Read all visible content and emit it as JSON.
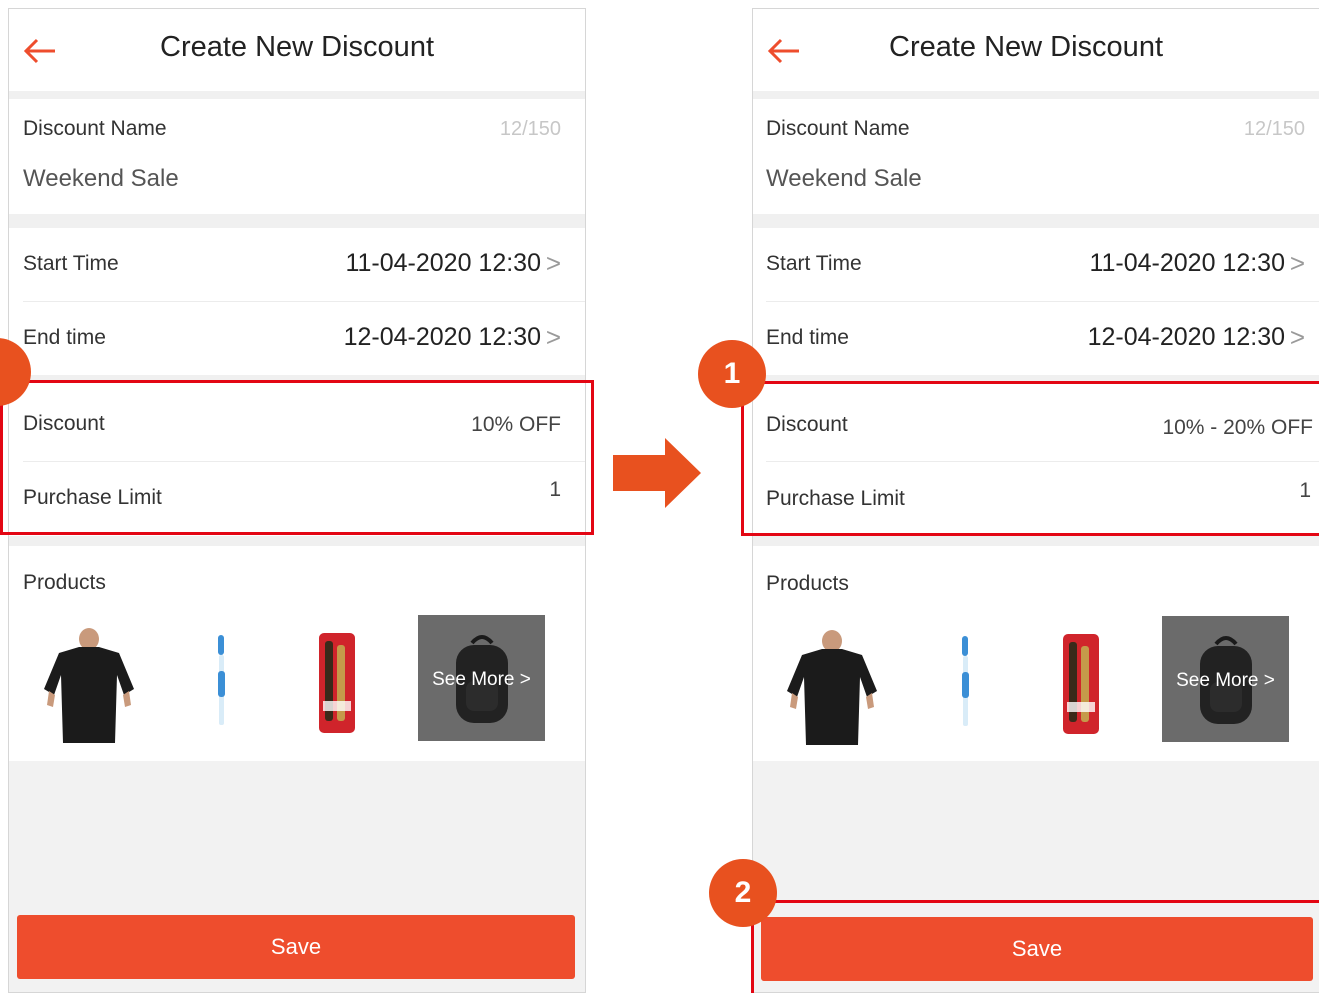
{
  "screens": [
    {
      "title": "Create New Discount",
      "discount_name": {
        "label": "Discount Name",
        "counter": "12/150",
        "value": "Weekend Sale"
      },
      "start_time": {
        "label": "Start Time",
        "value": "11-04-2020 12:30",
        "chevron": ">"
      },
      "end_time": {
        "label": "End time",
        "value": "12-04-2020 12:30",
        "chevron": ">"
      },
      "discount": {
        "label": "Discount",
        "value": "10% OFF"
      },
      "purchase_limit": {
        "label": "Purchase Limit",
        "value": "1"
      },
      "products": {
        "label": "Products",
        "items": [
          "tshirt",
          "toothbrush",
          "toothbrush-pack",
          "backpack"
        ],
        "see_more": "See More",
        "see_more_chevron": ">"
      },
      "save_label": "Save"
    },
    {
      "title": "Create New Discount",
      "discount_name": {
        "label": "Discount Name",
        "counter": "12/150",
        "value": "Weekend Sale"
      },
      "start_time": {
        "label": "Start Time",
        "value": "11-04-2020 12:30",
        "chevron": ">"
      },
      "end_time": {
        "label": "End time",
        "value": "12-04-2020 12:30",
        "chevron": ">"
      },
      "discount": {
        "label": "Discount",
        "value": "10% - 20% OFF"
      },
      "purchase_limit": {
        "label": "Purchase Limit",
        "value": "1"
      },
      "products": {
        "label": "Products",
        "items": [
          "tshirt",
          "toothbrush",
          "toothbrush-pack",
          "backpack"
        ],
        "see_more": "See More",
        "see_more_chevron": ">"
      },
      "save_label": "Save"
    }
  ],
  "callouts": [
    "1",
    "2"
  ],
  "icons": {
    "back": "arrow-left-icon",
    "flow": "arrow-right-icon"
  },
  "colors": {
    "accent": "#ee4d2d",
    "highlight": "#e30613",
    "badge": "#e8511f",
    "flow_arrow": "#e8511f"
  }
}
